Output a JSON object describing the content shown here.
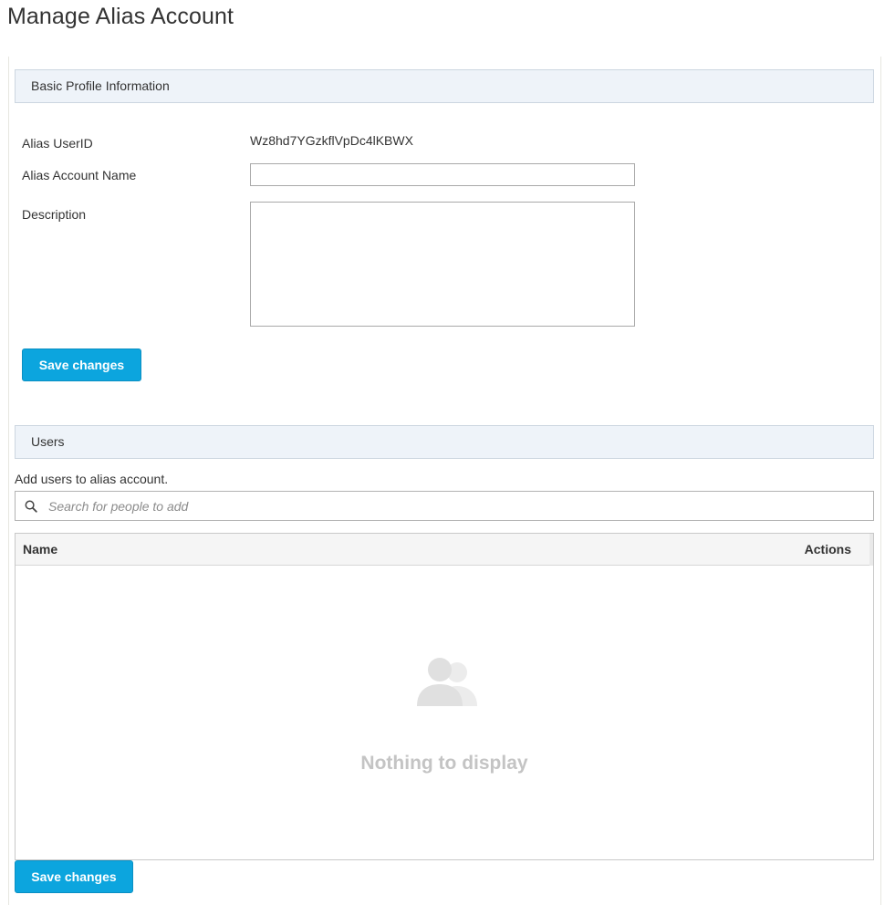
{
  "page": {
    "title": "Manage Alias Account"
  },
  "profile_section": {
    "header": "Basic Profile Information",
    "alias_userid_label": "Alias UserID",
    "alias_userid_value": "Wz8hd7YGzkflVpDc4lKBWX",
    "alias_account_name_label": "Alias Account Name",
    "alias_account_name_value": "",
    "description_label": "Description",
    "description_value": "",
    "save_label": "Save changes"
  },
  "users_section": {
    "header": "Users",
    "hint": "Add users to alias account.",
    "search": {
      "placeholder": "Search for people to add",
      "value": "",
      "icon": "search-icon"
    },
    "table": {
      "columns": [
        "Name",
        "Actions"
      ],
      "rows": [],
      "empty_icon": "users-icon",
      "empty_message": "Nothing to display"
    },
    "save_label": "Save changes"
  },
  "colors": {
    "accent": "#0ca5de",
    "section_header_bg": "#eef3f9",
    "empty_text": "#c4c4c4"
  }
}
